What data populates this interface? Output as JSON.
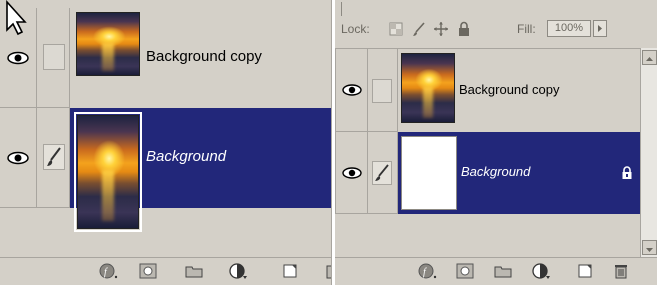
{
  "left_panel": {
    "layers": [
      {
        "name": "Background copy",
        "selected": false,
        "visible": true
      },
      {
        "name": "Background",
        "selected": true,
        "visible": true
      }
    ],
    "bottom_icons": [
      "layer-style-icon",
      "mask-icon",
      "folder-icon",
      "adjustment-layer-icon",
      "new-layer-icon",
      "delete-icon"
    ]
  },
  "right_panel": {
    "lock_label": "Lock:",
    "fill_label": "Fill:",
    "fill_value": "100%",
    "layers": [
      {
        "name": "Background copy",
        "selected": false,
        "visible": true
      },
      {
        "name": "Background",
        "selected": true,
        "visible": true,
        "locked": true
      }
    ],
    "bottom_icons": [
      "layer-style-icon",
      "mask-icon",
      "folder-icon",
      "adjustment-layer-icon",
      "new-layer-icon",
      "delete-icon"
    ]
  },
  "colors": {
    "panel_bg": "#d4d0c8",
    "selection": "#22277a",
    "divider": "#a8a59f"
  }
}
